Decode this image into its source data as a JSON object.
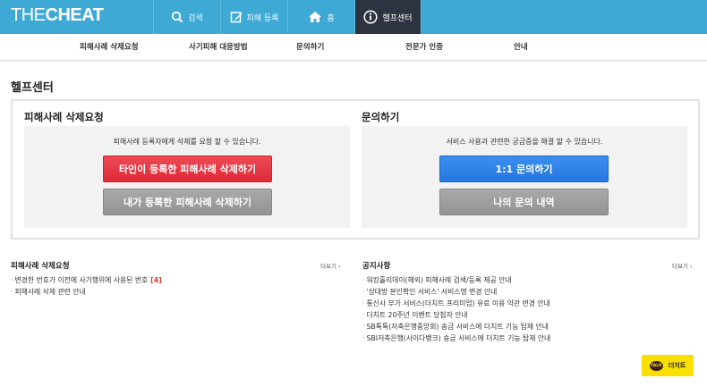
{
  "header": {
    "logo_the": "THE",
    "logo_cheat": "CHEAT",
    "nav": [
      {
        "label": "검색",
        "icon": "search-icon"
      },
      {
        "label": "피해 등록",
        "icon": "edit-icon"
      },
      {
        "label": "홈",
        "icon": "home-icon"
      },
      {
        "label": "헬프센터",
        "icon": "info-icon"
      }
    ],
    "active_index": 3
  },
  "subnav": [
    "피해사례 삭제요청",
    "사기피해 대응방법",
    "문의하기",
    "전문가 인증",
    "안내"
  ],
  "page": {
    "title": "헬프센터"
  },
  "delete_request": {
    "title": "피해사례 삭제요청",
    "desc": "피해사례 등록자에게 삭제를 요청 할 수 있습니다.",
    "btn_other": "타인이 등록한 피해사례 삭제하기",
    "btn_mine": "내가 등록한 피해사례 삭제하기"
  },
  "inquiry": {
    "title": "문의하기",
    "desc": "서비스 사용과 관련한 궁금증을 해결 할 수 있습니다.",
    "btn_one": "1:1 문의하기",
    "btn_history": "나의 문의 내역"
  },
  "delete_list": {
    "title": "피해사례 삭제요청",
    "more": "더보기 ›",
    "items": [
      {
        "text": "변경한 번호가 이전에 사기행위에 사용된 번호",
        "count": "[4]"
      },
      {
        "text": "피해사례 삭제 관련 안내",
        "count": ""
      }
    ]
  },
  "notice_list": {
    "title": "공지사항",
    "more": "더보기 ›",
    "items": [
      "워킹홀리데이(해외) 피해사례 검색/등록 제공 안내",
      "'상대방 본인확인 서비스' 서비스명 변경 안내",
      "통신사 부가 서비스(더치트 프리미엄) 유료 이용 약관 변경 안내",
      "더치트 20주년 이벤트 당첨자 안내",
      "SB톡톡(저축은행중앙회) 송금 서비스에 더치트 기능 탑재 안내",
      "SBI저축은행(사이다뱅크) 송금 서비스에 더치트 기능 탑재 안내"
    ]
  },
  "talk": {
    "badge": "TALK",
    "label": "더치트"
  },
  "colors": {
    "topbar": "#3fa9d6",
    "active_nav": "#2b3440",
    "red": "#de2a37",
    "blue": "#2677de",
    "gray": "#999999",
    "talk": "#f9e000"
  }
}
